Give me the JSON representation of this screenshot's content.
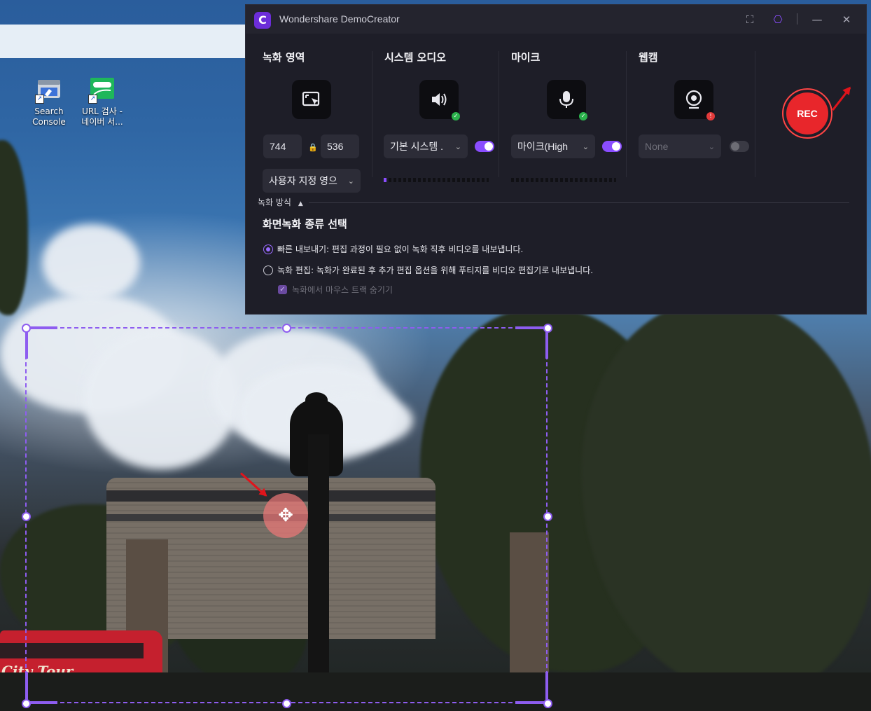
{
  "desktop": {
    "icons": [
      {
        "label_line1": "Search",
        "label_line2": "Console"
      },
      {
        "label_line1": "URL 검사 -",
        "label_line2": "네이버 서..."
      }
    ],
    "bus_text": "City Tour"
  },
  "app": {
    "title": "Wondershare DemoCreator",
    "logo_glyph": "C",
    "titlebar_buttons": {
      "screenshot_icon": "⛶",
      "settings_icon": "⎔",
      "minimize_icon": "—",
      "close_icon": "✕"
    },
    "recording_area": {
      "title": "녹화 영역",
      "width": "744",
      "height": "536",
      "preset": "사용자 지정 영으"
    },
    "system_audio": {
      "title": "시스템 오디오",
      "device": "기본 시스템 .",
      "enabled": true,
      "level": 0.03
    },
    "microphone": {
      "title": "마이크",
      "device": "마이크(High",
      "enabled": true,
      "level": 0
    },
    "webcam": {
      "title": "웹캠",
      "device": "None",
      "enabled": false
    },
    "rec_label": "REC",
    "recording_mode": {
      "label": "녹화 방식",
      "type_title": "화면녹화 종류 선택",
      "options": [
        {
          "label": "빠른 내보내기: 편집 과정이 필요 없이 녹화 직후 비디오를 내보냅니다.",
          "selected": true
        },
        {
          "label": "녹화 편집: 녹화가 완료된 후 추가 편집 옵션을 위해 푸티지를 비디오 편집기로 내보냅니다.",
          "selected": false
        }
      ],
      "hide_mouse_track": "녹화에서 마우스 트랙 숨기기"
    }
  },
  "colors": {
    "accent": "#8a4dff",
    "rec": "#e8262b",
    "selection": "#8e5df0"
  }
}
